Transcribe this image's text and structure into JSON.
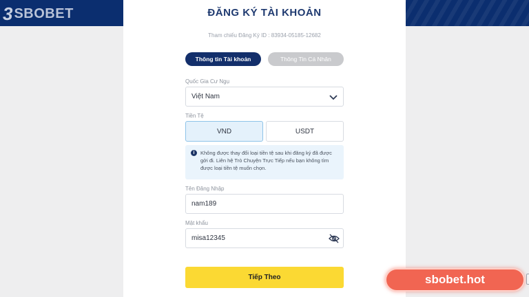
{
  "brand": {
    "logo_mark": "3",
    "logo_text": "SBOBET"
  },
  "card": {
    "title": "ĐĂNG KÝ TÀI KHOẢN",
    "reference": "Tham chiếu Đăng Ký ID : 83934-05185-12682"
  },
  "steps": [
    {
      "label": "Thông tin Tài khoản",
      "active": true
    },
    {
      "label": "Thông Tin Cá Nhân",
      "active": false
    }
  ],
  "form": {
    "country": {
      "label": "Quốc Gia Cư Ngụ",
      "value": "Việt Nam"
    },
    "currency": {
      "label": "Tiền Tệ",
      "options": [
        "VND",
        "USDT"
      ],
      "selected": "VND",
      "notice": "Không được thay đổi loại tiền tệ sau khi đăng ký đã được gởi đi. Liên hệ Trò Chuyện Trực Tiếp nếu bạn không tìm được loại tiền tệ muốn chọn."
    },
    "username": {
      "label": "Tên Đăng Nhập",
      "value": "nam189"
    },
    "password": {
      "label": "Mật khẩu",
      "value": "misa12345"
    },
    "next_label": "Tiếp Theo"
  },
  "watermark": "sbobet.hot",
  "icons": {
    "chevron": "chevron-down-icon",
    "info": "info-icon",
    "eye": "eye-slash-icon"
  },
  "colors": {
    "navy": "#132f6b",
    "accent_yellow": "#fbd933",
    "selected_blue": "#e4f1fb",
    "watermark_red": "#f16552"
  }
}
